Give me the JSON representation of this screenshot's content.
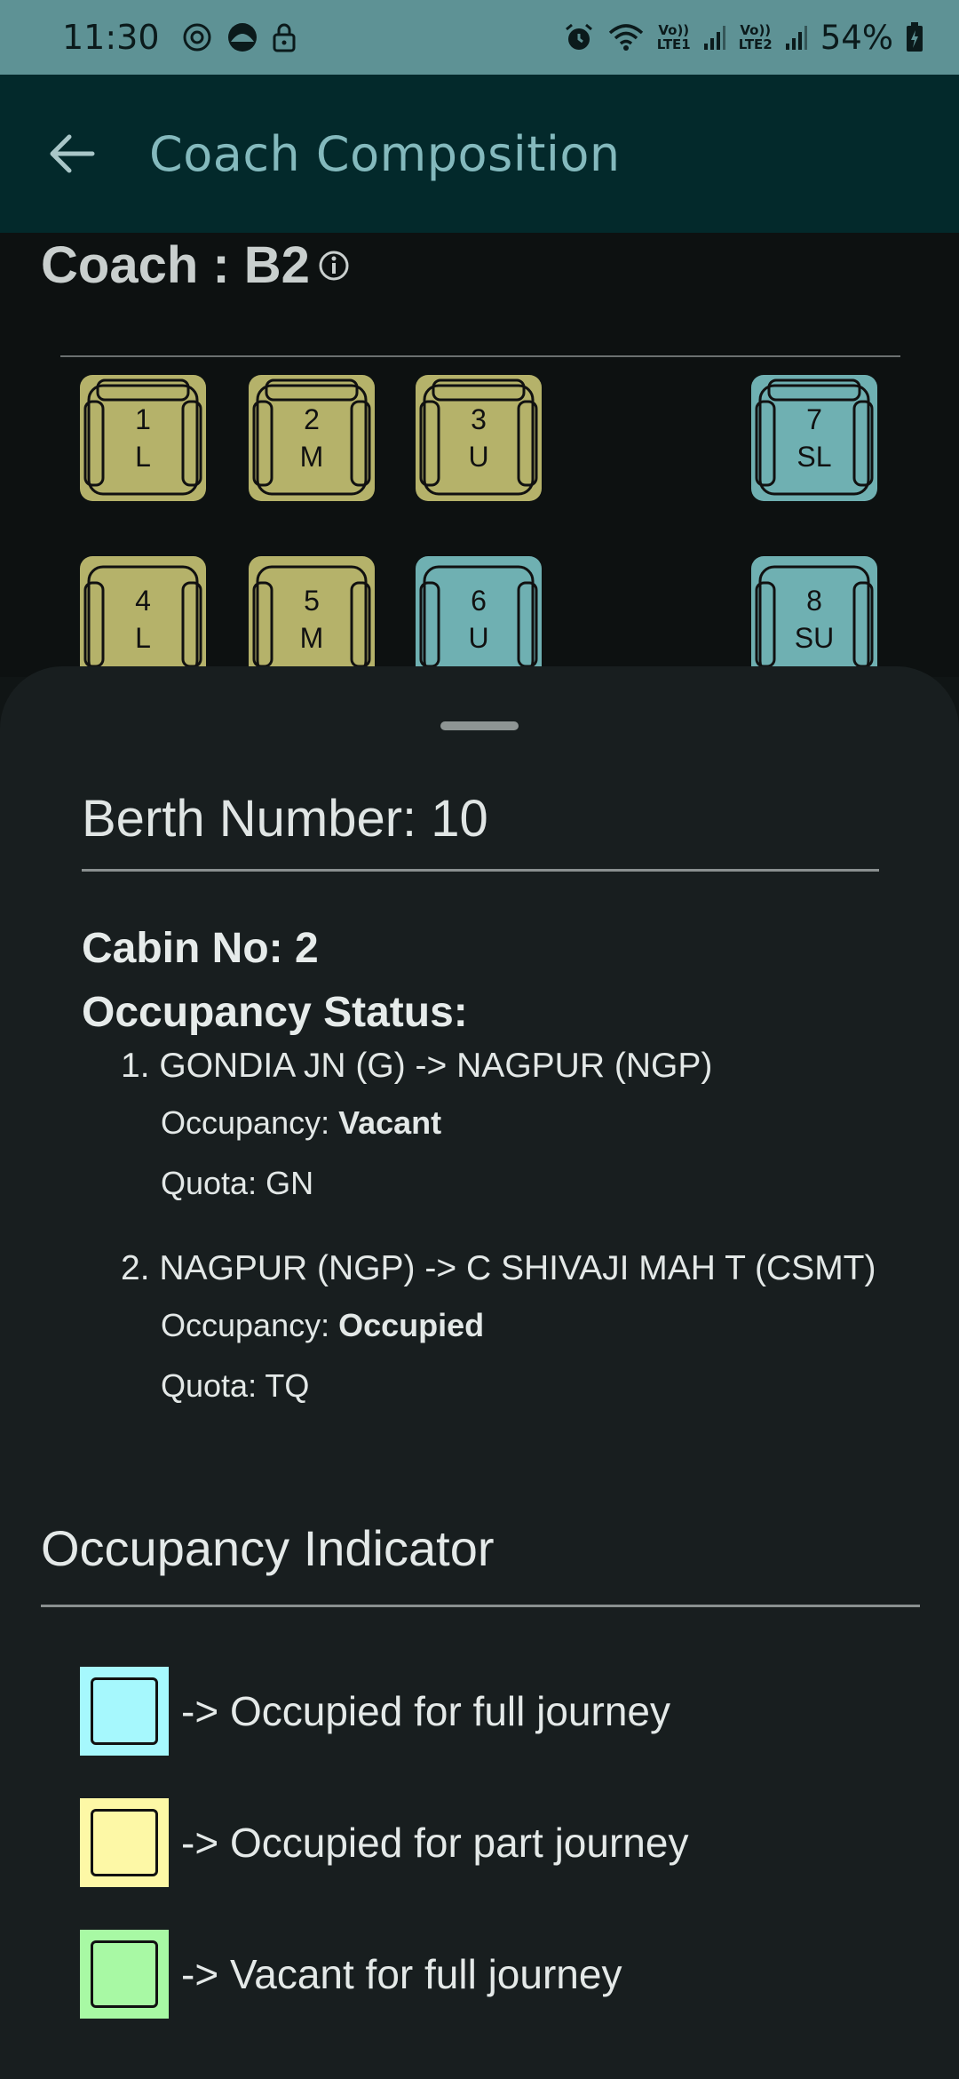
{
  "status_bar": {
    "time": "11:30",
    "battery_percent": "54%",
    "sim1_label_top": "Vo))",
    "sim1_label_bottom": "LTE1",
    "sim2_label_top": "Vo))",
    "sim2_label_bottom": "LTE2",
    "icons": [
      "data-saver-icon",
      "vpn-icon",
      "lock-icon",
      "alarm-icon",
      "wifi-icon",
      "signal-icon",
      "battery-charging-icon"
    ]
  },
  "app_bar": {
    "title": "Coach Composition",
    "back_icon": "arrow-left-icon"
  },
  "coach": {
    "label": "Coach : B2",
    "info_icon": "info-icon",
    "berths": [
      {
        "number": "1",
        "type": "L",
        "status": "part"
      },
      {
        "number": "2",
        "type": "M",
        "status": "part"
      },
      {
        "number": "3",
        "type": "U",
        "status": "part"
      },
      {
        "number": "7",
        "type": "SL",
        "status": "full"
      },
      {
        "number": "4",
        "type": "L",
        "status": "part"
      },
      {
        "number": "5",
        "type": "M",
        "status": "part"
      },
      {
        "number": "6",
        "type": "U",
        "status": "full"
      },
      {
        "number": "8",
        "type": "SU",
        "status": "full"
      }
    ]
  },
  "sheet": {
    "berth_heading": "Berth Number: 10",
    "cabin": "Cabin No: 2",
    "occupancy_status_label": "Occupancy Status:",
    "segments": [
      {
        "route": "1. GONDIA JN (G) -> NAGPUR (NGP)",
        "occupancy_label": "Occupancy: ",
        "occupancy_value": "Vacant",
        "quota": "Quota: GN"
      },
      {
        "route": "2. NAGPUR (NGP) -> C SHIVAJI MAH T (CSMT)",
        "occupancy_label": "Occupancy: ",
        "occupancy_value": "Occupied",
        "quota": "Quota: TQ"
      }
    ],
    "indicator_title": "Occupancy Indicator",
    "legend": [
      {
        "text": "-> Occupied for full journey",
        "color": "#a6f8fd"
      },
      {
        "text": "-> Occupied for part journey",
        "color": "#fdf8a6"
      },
      {
        "text": "-> Vacant for full journey",
        "color": "#a8f9a4"
      }
    ]
  },
  "colors": {
    "status_bar": "#5e9295",
    "app_bar": "#03292b",
    "title_text": "#84b9bd",
    "berth_part": "#b5b26a",
    "berth_full": "#6fb0b2",
    "sheet_bg": "#181e1f"
  }
}
